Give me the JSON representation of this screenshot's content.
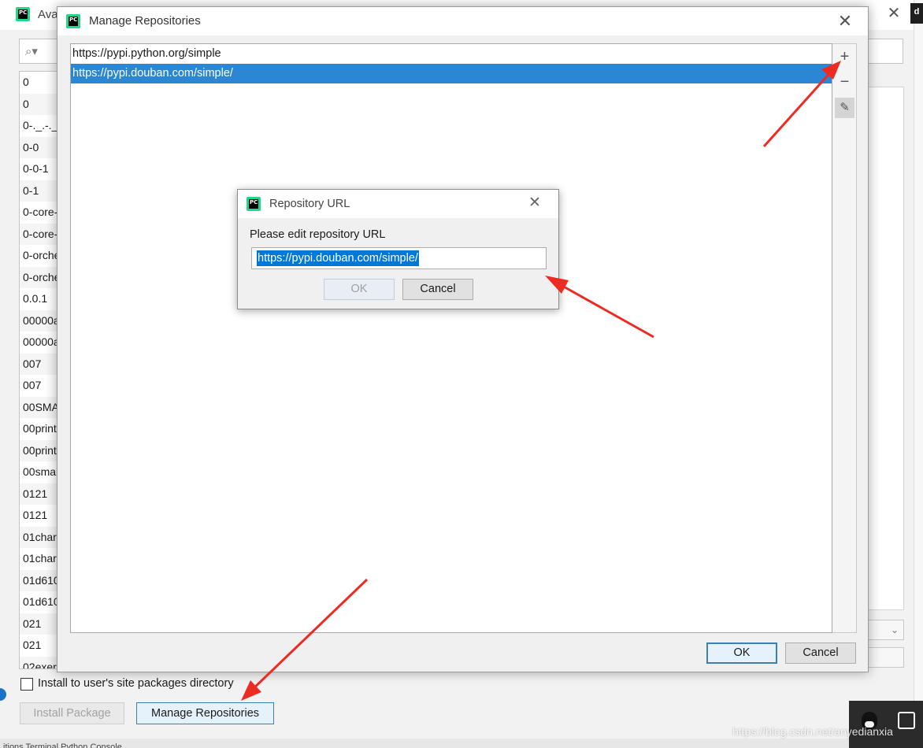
{
  "background": {
    "title": "Ava",
    "search_icon": "search-icon",
    "packages": [
      "0",
      "0",
      "0-._.-._",
      "0-0",
      "0-0-1",
      "0-1",
      "0-core-",
      "0-core-",
      "0-orche",
      "0-orche",
      "0.0.1",
      "00000a",
      "00000a",
      "007",
      "007",
      "00SMA",
      "00print",
      "00print",
      "00smal",
      "0121",
      "0121",
      "01char",
      "01char",
      "01d610",
      "01d610",
      "021",
      "021",
      "02exer"
    ],
    "install_checkbox_label": "Install to user's site packages directory",
    "install_button": "Install Package",
    "manage_button": "Manage Repositories",
    "bottom_strip": "itions   Terminal   Python Console",
    "edge_badge": "d"
  },
  "manage_dialog": {
    "title": "Manage Repositories",
    "repositories": [
      {
        "url": "https://pypi.python.org/simple",
        "selected": false
      },
      {
        "url": "https://pypi.douban.com/simple/",
        "selected": true
      }
    ],
    "toolbar": {
      "add": "+",
      "remove": "−",
      "edit": "✎"
    },
    "ok_label": "OK",
    "cancel_label": "Cancel"
  },
  "url_dialog": {
    "title": "Repository URL",
    "prompt": "Please edit repository URL",
    "url_value": "https://pypi.douban.com/simple/",
    "ok_label": "OK",
    "cancel_label": "Cancel"
  },
  "logo_text": "PC",
  "watermark": "https://blog.csdn.net/anyedianxia",
  "colors": {
    "selection": "#2b86d3",
    "input_selection": "#0078d7",
    "primary_button_border": "#3c7fb1",
    "arrow": "#ee2b22"
  }
}
